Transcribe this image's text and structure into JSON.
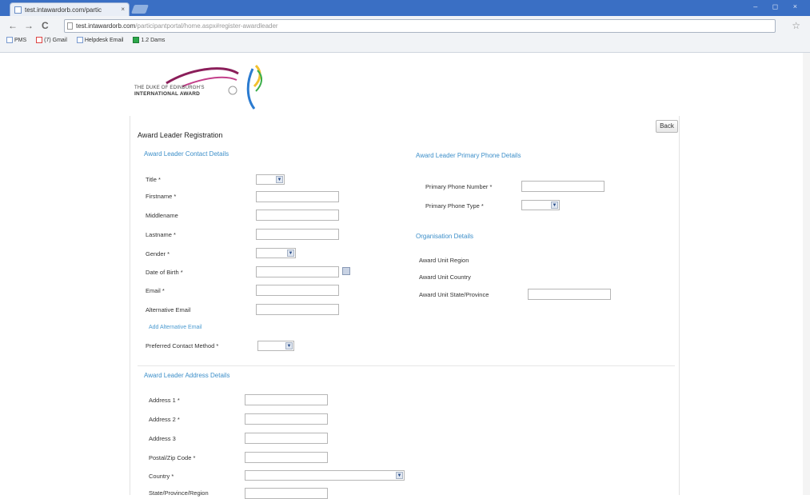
{
  "browser": {
    "tab_title": "test.intawardorb.com/partic",
    "tab_close": "×",
    "window_controls": "– ◻ ×",
    "back": "←",
    "forward": "→",
    "reload": "C",
    "url_host": "test.intawardorb.com",
    "url_path": "/participantportal/home.aspx#register-awardleader",
    "star": "☆",
    "bookmarks": [
      {
        "label": "PMS"
      },
      {
        "label": "(7) Gmail"
      },
      {
        "label": "Helpdesk Email"
      },
      {
        "label": "1.2 Dams"
      }
    ]
  },
  "logo": {
    "line1": "THE DUKE OF EDINBURGH'S",
    "line2": "INTERNATIONAL AWARD"
  },
  "page": {
    "title": "Award Leader Registration",
    "back_button": "Back"
  },
  "contact": {
    "heading": "Award Leader Contact Details",
    "title_label": "Title *",
    "firstname_label": "Firstname *",
    "middlename_label": "Middlename",
    "lastname_label": "Lastname *",
    "gender_label": "Gender *",
    "dob_label": "Date of Birth *",
    "email_label": "Email *",
    "alt_email_label": "Alternative Email",
    "add_alt_email_link": "Add Alternative Email",
    "preferred_contact_label": "Preferred Contact Method *"
  },
  "phone": {
    "heading": "Award Leader Primary Phone Details",
    "number_label": "Primary Phone Number *",
    "type_label": "Primary Phone Type *"
  },
  "organisation": {
    "heading": "Organisation Details",
    "region_label": "Award Unit Region",
    "country_label": "Award Unit Country",
    "state_label": "Award Unit State/Province"
  },
  "address": {
    "heading": "Award Leader Address Details",
    "address1_label": "Address 1 *",
    "address2_label": "Address 2 *",
    "address3_label": "Address 3",
    "postal_label": "Postal/Zip Code *",
    "country_label": "Country *",
    "state_label": "State/Province/Region"
  },
  "icons": {
    "dropdown_arrow": "▼"
  },
  "colors": {
    "section_heading": "#3d8fc9",
    "title_bar": "#3a6fc4"
  }
}
